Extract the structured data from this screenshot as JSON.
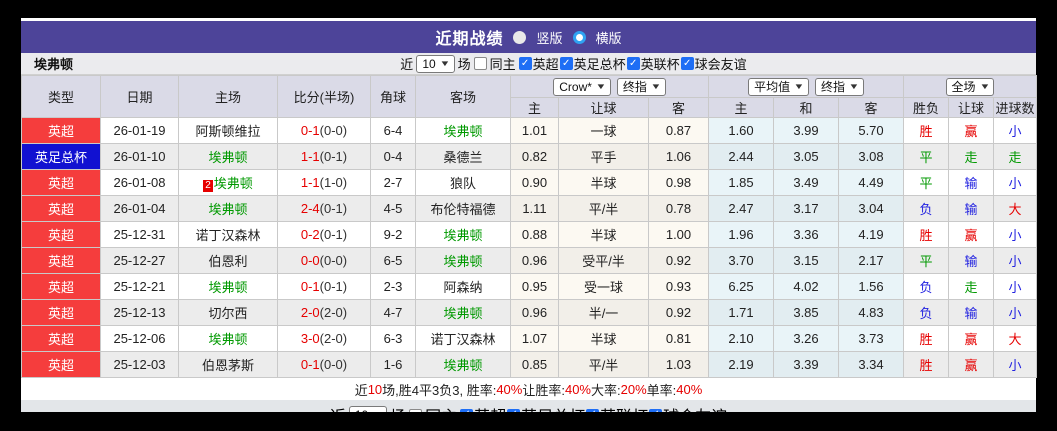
{
  "title_bar": {
    "title": "近期战绩",
    "radio_vertical_label": "竖版",
    "radio_horizontal_label": "横版"
  },
  "filter_bar": {
    "team": "埃弗顿",
    "near_label": "近",
    "count_value": "10",
    "matches_label": "场",
    "same_home_label": "同主",
    "leagues": [
      "英超",
      "英足总杯",
      "英联杯",
      "球会友谊"
    ]
  },
  "table": {
    "headers": {
      "type": "类型",
      "date": "日期",
      "home": "主场",
      "score": "比分(半场)",
      "corner": "角球",
      "away": "客场"
    },
    "selectors": {
      "asia_source": "Crow*",
      "asia_time": "终指",
      "euro_source": "平均值",
      "euro_time": "终指",
      "scope": "全场"
    },
    "sub_headers": {
      "asia_home": "主",
      "handicap": "让球",
      "asia_away": "客",
      "euro_home": "主",
      "draw": "和",
      "euro_away": "客",
      "result": "胜负",
      "handicap_result": "让球",
      "goals": "进球数"
    },
    "rows": [
      {
        "type": "英超",
        "type_color": "red",
        "date": "26-01-19",
        "home": "阿斯顿维拉",
        "home_color": "black",
        "home_badge": "",
        "score": "0-1",
        "half": "(0-0)",
        "corner": "6-4",
        "away": "埃弗顿",
        "away_color": "green",
        "asia_home": "1.01",
        "handicap": "一球",
        "asia_away": "0.87",
        "euro_home": "1.60",
        "euro_draw": "3.99",
        "euro_away": "5.70",
        "result": "胜",
        "result_color": "red",
        "handicap_result": "赢",
        "handicap_result_color": "red",
        "goals": "小",
        "goals_color": "blue"
      },
      {
        "type": "英足总杯",
        "type_color": "blue",
        "date": "26-01-10",
        "home": "埃弗顿",
        "home_color": "green",
        "home_badge": "",
        "score": "1-1",
        "half": "(0-1)",
        "corner": "0-4",
        "away": "桑德兰",
        "away_color": "black",
        "asia_home": "0.82",
        "handicap": "平手",
        "asia_away": "1.06",
        "euro_home": "2.44",
        "euro_draw": "3.05",
        "euro_away": "3.08",
        "result": "平",
        "result_color": "green",
        "handicap_result": "走",
        "handicap_result_color": "green",
        "goals": "走",
        "goals_color": "green"
      },
      {
        "type": "英超",
        "type_color": "red",
        "date": "26-01-08",
        "home": "埃弗顿",
        "home_color": "green",
        "home_badge": "2",
        "score": "1-1",
        "half": "(1-0)",
        "corner": "2-7",
        "away": "狼队",
        "away_color": "black",
        "asia_home": "0.90",
        "handicap": "半球",
        "asia_away": "0.98",
        "euro_home": "1.85",
        "euro_draw": "3.49",
        "euro_away": "4.49",
        "result": "平",
        "result_color": "green",
        "handicap_result": "输",
        "handicap_result_color": "blue",
        "goals": "小",
        "goals_color": "blue"
      },
      {
        "type": "英超",
        "type_color": "red",
        "date": "26-01-04",
        "home": "埃弗顿",
        "home_color": "green",
        "home_badge": "",
        "score": "2-4",
        "half": "(0-1)",
        "corner": "4-5",
        "away": "布伦特福德",
        "away_color": "black",
        "asia_home": "1.11",
        "handicap": "平/半",
        "asia_away": "0.78",
        "euro_home": "2.47",
        "euro_draw": "3.17",
        "euro_away": "3.04",
        "result": "负",
        "result_color": "blue",
        "handicap_result": "输",
        "handicap_result_color": "blue",
        "goals": "大",
        "goals_color": "red"
      },
      {
        "type": "英超",
        "type_color": "red",
        "date": "25-12-31",
        "home": "诺丁汉森林",
        "home_color": "black",
        "home_badge": "",
        "score": "0-2",
        "half": "(0-1)",
        "corner": "9-2",
        "away": "埃弗顿",
        "away_color": "green",
        "asia_home": "0.88",
        "handicap": "半球",
        "asia_away": "1.00",
        "euro_home": "1.96",
        "euro_draw": "3.36",
        "euro_away": "4.19",
        "result": "胜",
        "result_color": "red",
        "handicap_result": "赢",
        "handicap_result_color": "red",
        "goals": "小",
        "goals_color": "blue"
      },
      {
        "type": "英超",
        "type_color": "red",
        "date": "25-12-27",
        "home": "伯恩利",
        "home_color": "black",
        "home_badge": "",
        "score": "0-0",
        "half": "(0-0)",
        "corner": "6-5",
        "away": "埃弗顿",
        "away_color": "green",
        "asia_home": "0.96",
        "handicap": "受平/半",
        "asia_away": "0.92",
        "euro_home": "3.70",
        "euro_draw": "3.15",
        "euro_away": "2.17",
        "result": "平",
        "result_color": "green",
        "handicap_result": "输",
        "handicap_result_color": "blue",
        "goals": "小",
        "goals_color": "blue"
      },
      {
        "type": "英超",
        "type_color": "red",
        "date": "25-12-21",
        "home": "埃弗顿",
        "home_color": "green",
        "home_badge": "",
        "score": "0-1",
        "half": "(0-1)",
        "corner": "2-3",
        "away": "阿森纳",
        "away_color": "black",
        "asia_home": "0.95",
        "handicap": "受一球",
        "asia_away": "0.93",
        "euro_home": "6.25",
        "euro_draw": "4.02",
        "euro_away": "1.56",
        "result": "负",
        "result_color": "blue",
        "handicap_result": "走",
        "handicap_result_color": "green",
        "goals": "小",
        "goals_color": "blue"
      },
      {
        "type": "英超",
        "type_color": "red",
        "date": "25-12-13",
        "home": "切尔西",
        "home_color": "black",
        "home_badge": "",
        "score": "2-0",
        "half": "(2-0)",
        "corner": "4-7",
        "away": "埃弗顿",
        "away_color": "green",
        "asia_home": "0.96",
        "handicap": "半/一",
        "asia_away": "0.92",
        "euro_home": "1.71",
        "euro_draw": "3.85",
        "euro_away": "4.83",
        "result": "负",
        "result_color": "blue",
        "handicap_result": "输",
        "handicap_result_color": "blue",
        "goals": "小",
        "goals_color": "blue"
      },
      {
        "type": "英超",
        "type_color": "red",
        "date": "25-12-06",
        "home": "埃弗顿",
        "home_color": "green",
        "home_badge": "",
        "score": "3-0",
        "half": "(2-0)",
        "corner": "6-3",
        "away": "诺丁汉森林",
        "away_color": "black",
        "asia_home": "1.07",
        "handicap": "半球",
        "asia_away": "0.81",
        "euro_home": "2.10",
        "euro_draw": "3.26",
        "euro_away": "3.73",
        "result": "胜",
        "result_color": "red",
        "handicap_result": "赢",
        "handicap_result_color": "red",
        "goals": "大",
        "goals_color": "red"
      },
      {
        "type": "英超",
        "type_color": "red",
        "date": "25-12-03",
        "home": "伯恩茅斯",
        "home_color": "black",
        "home_badge": "",
        "score": "0-1",
        "half": "(0-0)",
        "corner": "1-6",
        "away": "埃弗顿",
        "away_color": "green",
        "asia_home": "0.85",
        "handicap": "平/半",
        "asia_away": "1.03",
        "euro_home": "2.19",
        "euro_draw": "3.39",
        "euro_away": "3.34",
        "result": "胜",
        "result_color": "red",
        "handicap_result": "赢",
        "handicap_result_color": "red",
        "goals": "小",
        "goals_color": "blue"
      }
    ]
  },
  "summary": {
    "segments": [
      {
        "t": "近",
        "c": "black"
      },
      {
        "t": "10",
        "c": "red"
      },
      {
        "t": "场,胜4平3负3, 胜率:",
        "c": "black"
      },
      {
        "t": "40%",
        "c": "red"
      },
      {
        "t": " 让胜率:",
        "c": "black"
      },
      {
        "t": "40%",
        "c": "red"
      },
      {
        "t": " 大率:",
        "c": "black"
      },
      {
        "t": "20%",
        "c": "red"
      },
      {
        "t": " 单率:",
        "c": "black"
      },
      {
        "t": "40%",
        "c": "red"
      }
    ]
  },
  "colors": {
    "titlebar_purple": "#4d4499",
    "badge_red": "#f53d3d",
    "badge_blue": "#1111d1",
    "win_red": "#e60000",
    "draw_green": "#009900",
    "lose_blue": "#2222e0",
    "checkbox_blue": "#1e6ef5",
    "asia_bg": "#fcf9f2",
    "euro_bg": "#e9f4f8"
  }
}
